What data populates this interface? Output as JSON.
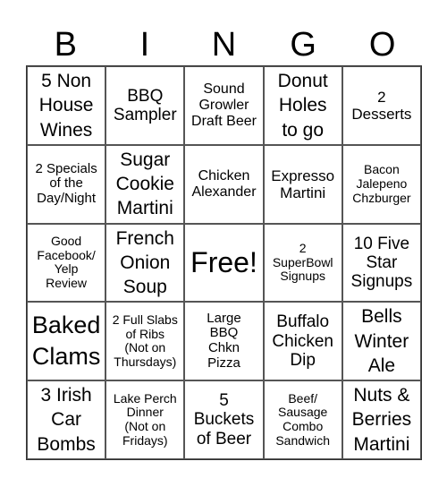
{
  "header": [
    "B",
    "I",
    "N",
    "G",
    "O"
  ],
  "cells": [
    {
      "text": "5 Non\nHouse\nWines",
      "size": "s21"
    },
    {
      "text": "BBQ\nSampler",
      "size": "s19"
    },
    {
      "text": "Sound\nGrowler\nDraft Beer",
      "size": "s16"
    },
    {
      "text": "Donut\nHoles\nto go",
      "size": "s21"
    },
    {
      "text": "2\nDesserts",
      "size": "s17"
    },
    {
      "text": "2 Specials\nof the\nDay/Night",
      "size": "s15"
    },
    {
      "text": "Sugar\nCookie\nMartini",
      "size": "s21"
    },
    {
      "text": "Chicken\nAlexander",
      "size": "s16"
    },
    {
      "text": "Expresso\nMartini",
      "size": "s17"
    },
    {
      "text": "Bacon\nJalepeno\nChzburger",
      "size": "s14"
    },
    {
      "text": "Good\nFacebook/\nYelp\nReview",
      "size": "s14"
    },
    {
      "text": "French\nOnion\nSoup",
      "size": "s21"
    },
    {
      "text": "Free!",
      "size": "s32"
    },
    {
      "text": "2\nSuperBowl\nSignups",
      "size": "s14"
    },
    {
      "text": "10 Five\nStar\nSignups",
      "size": "s19"
    },
    {
      "text": "Baked\nClams",
      "size": "s27"
    },
    {
      "text": "2 Full Slabs\nof Ribs\n(Not on\nThursdays)",
      "size": "s14"
    },
    {
      "text": "Large\nBBQ\nChkn\nPizza",
      "size": "s15"
    },
    {
      "text": "Buffalo\nChicken\nDip",
      "size": "s19"
    },
    {
      "text": "Bells\nWinter\nAle",
      "size": "s21"
    },
    {
      "text": "3 Irish\nCar\nBombs",
      "size": "s21"
    },
    {
      "text": "Lake Perch\nDinner\n(Not on\nFridays)",
      "size": "s14"
    },
    {
      "text": "5\nBuckets\nof Beer",
      "size": "s19"
    },
    {
      "text": "Beef/\nSausage\nCombo\nSandwich",
      "size": "s14"
    },
    {
      "text": "Nuts &\nBerries\nMartini",
      "size": "s21"
    }
  ]
}
